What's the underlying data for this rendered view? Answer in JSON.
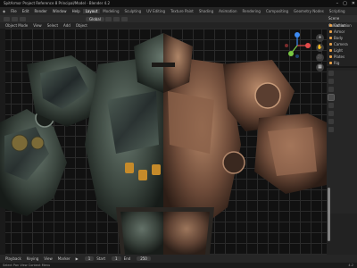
{
  "titlebar": {
    "title": "SpitArmor Project Reference 8 Principal/Model - Blender 4.2",
    "controls": [
      "–",
      "▢",
      "✕"
    ]
  },
  "menubar": {
    "menus": [
      "File",
      "Edit",
      "Render",
      "Window",
      "Help"
    ],
    "workspaces": [
      "Layout",
      "Modeling",
      "Sculpting",
      "UV Editing",
      "Texture Paint",
      "Shading",
      "Animation",
      "Rendering",
      "Compositing",
      "Geometry Nodes",
      "Scripting"
    ],
    "active_workspace": "Layout"
  },
  "toolbar": {
    "mode": "Object Mode",
    "items": [
      "View",
      "Select",
      "Add",
      "Object"
    ],
    "transform": "Global"
  },
  "subbar": {
    "items": [
      "Object",
      "View",
      "Select",
      "Add"
    ]
  },
  "viewport": {
    "nav_buttons": [
      "+",
      "✋",
      "🎥",
      "▦"
    ],
    "gizmo_axes": [
      "X",
      "Y",
      "Z"
    ],
    "colors": {
      "x": "#e34a4a",
      "y": "#7ac943",
      "z": "#3d8bf2"
    }
  },
  "outliner": {
    "header": "Scene Collection",
    "rows": [
      "Collection",
      "Armor",
      "Body",
      "Camera",
      "Light",
      "Plates",
      "Rig"
    ]
  },
  "timeline": {
    "items": [
      "Playback",
      "Keying",
      "View",
      "Marker"
    ],
    "frame_current": "1",
    "start_label": "Start",
    "start": "1",
    "end_label": "End",
    "end": "250"
  },
  "statusbar": {
    "left": "Select   Pan View   Context Menu",
    "right": "4.2"
  }
}
